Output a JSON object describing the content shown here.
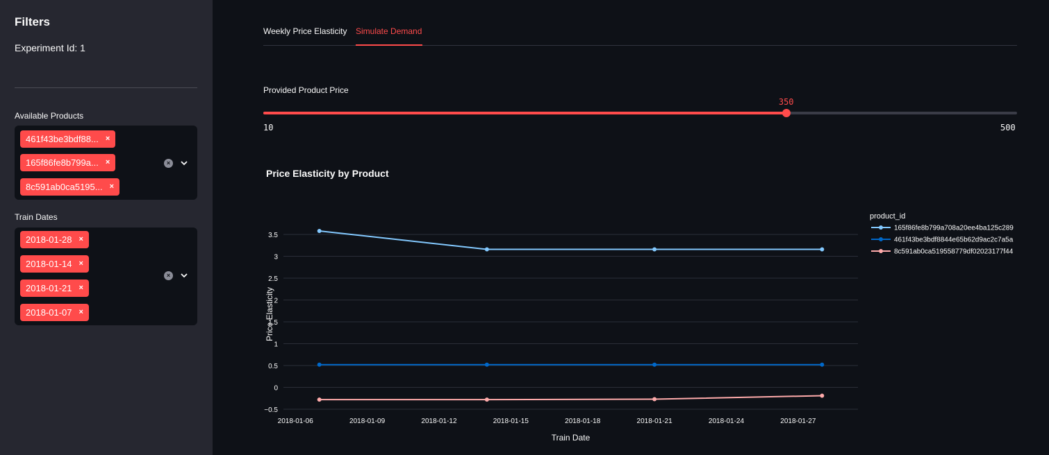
{
  "sidebar": {
    "title": "Filters",
    "experiment": "Experiment Id: 1",
    "products_label": "Available Products",
    "products": [
      "461f43be3bdf88...",
      "165f86fe8b799a...",
      "8c591ab0ca5195..."
    ],
    "dates_label": "Train Dates",
    "dates": [
      "2018-01-28",
      "2018-01-14",
      "2018-01-21",
      "2018-01-07"
    ],
    "remove_glyph": "×",
    "clear_glyph": "×"
  },
  "tabs": [
    {
      "label": "Weekly Price Elasticity",
      "active": false
    },
    {
      "label": "Simulate Demand",
      "active": true
    }
  ],
  "slider": {
    "label": "Provided Product Price",
    "min": 10,
    "max": 500,
    "value": 350,
    "min_label": "10",
    "max_label": "500",
    "value_label": "350"
  },
  "colors": {
    "accent": "#ff4b4b",
    "background": "#0e1117",
    "sidebar": "#262730"
  },
  "chart_data": {
    "type": "line",
    "title": "Price Elasticity by Product",
    "xlabel": "Train Date",
    "ylabel": "Price Elasticity",
    "legend_title": "product_id",
    "legend_position": "right",
    "grid": true,
    "x": [
      "2018-01-07",
      "2018-01-14",
      "2018-01-21",
      "2018-01-28"
    ],
    "xlim": [
      "2018-01-05 12:00",
      "2018-01-29 12:00"
    ],
    "xticks": [
      "2018-01-06",
      "2018-01-09",
      "2018-01-12",
      "2018-01-15",
      "2018-01-18",
      "2018-01-21",
      "2018-01-24",
      "2018-01-27"
    ],
    "ylim": [
      -0.5,
      3.85
    ],
    "yticks": [
      -0.5,
      0,
      0.5,
      1,
      1.5,
      2,
      2.5,
      3,
      3.5
    ],
    "ytick_labels": [
      "−0.5",
      "0",
      "0.5",
      "1",
      "1.5",
      "2",
      "2.5",
      "3",
      "3.5"
    ],
    "series": [
      {
        "name": "165f86fe8b799a708a20ee4ba125c289",
        "color": "#83c9ff",
        "values": [
          3.58,
          3.16,
          3.16,
          3.16
        ]
      },
      {
        "name": "461f43be3bdf8844e65b62d9ac2c7a5a",
        "color": "#0068c9",
        "values": [
          0.52,
          0.52,
          0.52,
          0.52
        ]
      },
      {
        "name": "8c591ab0ca519558779df02023177f44",
        "color": "#ffabab",
        "values": [
          -0.28,
          -0.28,
          -0.27,
          -0.19
        ]
      }
    ]
  }
}
